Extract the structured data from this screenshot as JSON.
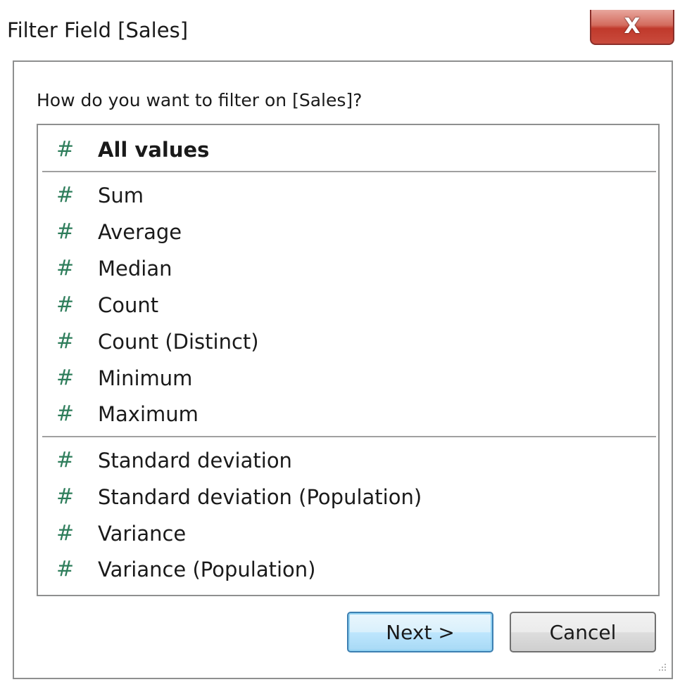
{
  "window": {
    "title": "Filter Field [Sales]",
    "close_label": "X"
  },
  "prompt": "How do you want to filter on [Sales]?",
  "list": {
    "icon": "#",
    "items": [
      {
        "label": "All values",
        "bold": true
      },
      {
        "label": "Sum",
        "bold": false
      },
      {
        "label": "Average",
        "bold": false
      },
      {
        "label": "Median",
        "bold": false
      },
      {
        "label": "Count",
        "bold": false
      },
      {
        "label": "Count (Distinct)",
        "bold": false
      },
      {
        "label": "Minimum",
        "bold": false
      },
      {
        "label": "Maximum",
        "bold": false
      },
      {
        "label": "Standard deviation",
        "bold": false
      },
      {
        "label": "Standard deviation (Population)",
        "bold": false
      },
      {
        "label": "Variance",
        "bold": false
      },
      {
        "label": "Variance (Population)",
        "bold": false
      }
    ]
  },
  "buttons": {
    "next_label": "Next >",
    "cancel_label": "Cancel"
  },
  "colors": {
    "measure_icon": "#2e7d5b",
    "close_button": "#c0392b",
    "default_button_border": "#3c7fb1"
  }
}
